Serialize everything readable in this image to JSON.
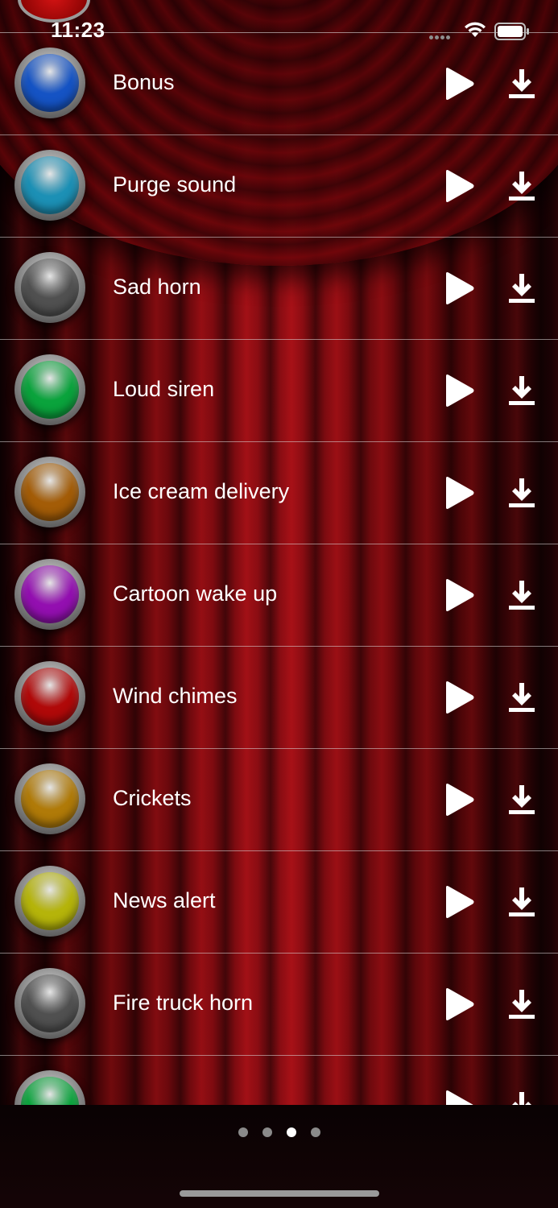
{
  "status_bar": {
    "time": "11:23"
  },
  "sounds": [
    {
      "label": "Bonus",
      "color": "#1553c4"
    },
    {
      "label": "Purge sound",
      "color": "#1c90b5"
    },
    {
      "label": "Sad horn",
      "color": "#505050"
    },
    {
      "label": "Loud siren",
      "color": "#0aa33c"
    },
    {
      "label": "Ice cream delivery",
      "color": "#a35c07"
    },
    {
      "label": "Cartoon wake up",
      "color": "#930fb0"
    },
    {
      "label": "Wind chimes",
      "color": "#b00909"
    },
    {
      "label": "Crickets",
      "color": "#b07a08"
    },
    {
      "label": "News alert",
      "color": "#b5b40a"
    },
    {
      "label": "Fire truck horn",
      "color": "#505050"
    },
    {
      "label": "",
      "color": "#0aa33c"
    }
  ],
  "pager": {
    "count": 4,
    "active_index": 2
  },
  "icons": {
    "play": "play-icon",
    "download": "download-icon"
  }
}
